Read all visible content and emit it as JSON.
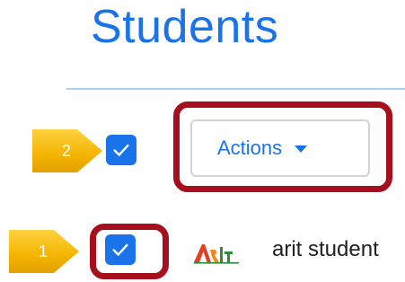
{
  "header": {
    "title": "Students"
  },
  "steps": [
    {
      "number": "2"
    },
    {
      "number": "1"
    }
  ],
  "toolbar": {
    "select_all_checked": true,
    "actions_label": "Actions"
  },
  "student_row": {
    "checked": true,
    "name": "arit student",
    "logo_icon": "arit-logo-icon"
  },
  "colors": {
    "accent": "#1a73e8",
    "highlight": "#a6101c",
    "badge": "#f4b400"
  }
}
